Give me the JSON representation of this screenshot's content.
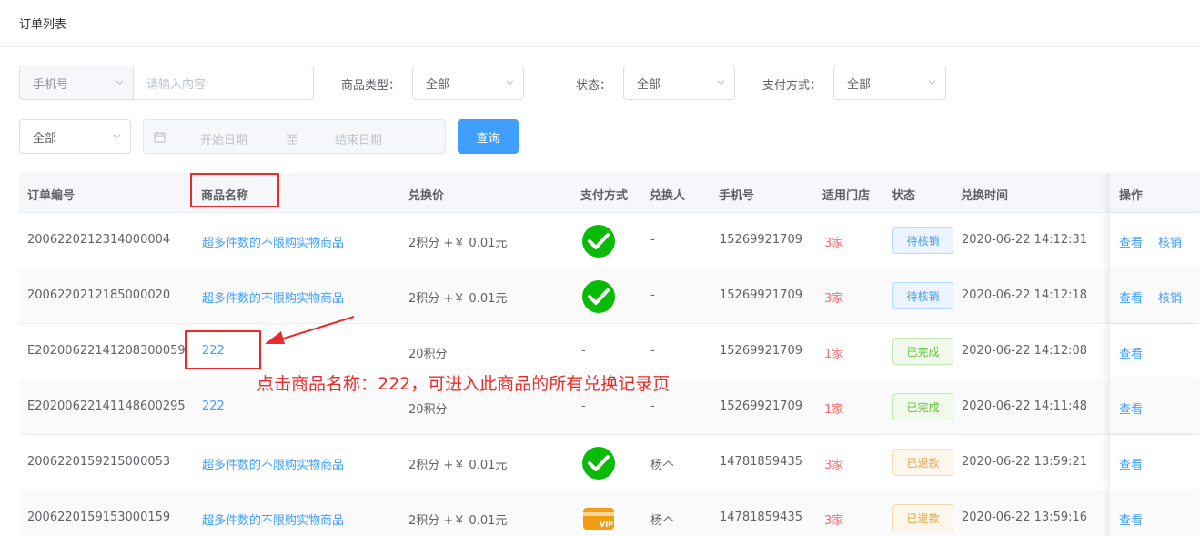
{
  "page": {
    "title": "订单列表"
  },
  "filters": {
    "search_type": "手机号",
    "search_placeholder": "请输入内容",
    "product_type_label": "商品类型：",
    "product_type_value": "全部",
    "status_label": "状态：",
    "status_value": "全部",
    "pay_method_label": "支付方式：",
    "pay_method_value": "全部",
    "store_value": "全部",
    "start_date_placeholder": "开始日期",
    "date_separator": "至",
    "end_date_placeholder": "结束日期",
    "query_button": "查询"
  },
  "table": {
    "headers": {
      "order_no": "订单编号",
      "product_name": "商品名称",
      "price": "兑换价",
      "pay_method": "支付方式",
      "redeemer": "兑换人",
      "phone": "手机号",
      "stores": "适用门店",
      "status": "状态",
      "time": "兑换时间",
      "actions": "操作"
    },
    "rows": [
      {
        "order_no": "2006220212314000004",
        "product": "超多件数的不限购实物商品",
        "price": "2积分 +￥ 0.01元",
        "pay": "wechat-pay-icon",
        "redeemer": "-",
        "phone": "15269921709",
        "stores": "3家",
        "status": "待核销",
        "status_type": "pending",
        "time": "2020-06-22 14:12:31",
        "view": "查看",
        "verify": "核销"
      },
      {
        "order_no": "2006220212185000020",
        "product": "超多件数的不限购实物商品",
        "price": "2积分 +￥ 0.01元",
        "pay": "wechat-pay-icon",
        "redeemer": "-",
        "phone": "15269921709",
        "stores": "3家",
        "status": "待核销",
        "status_type": "pending",
        "time": "2020-06-22 14:12:18",
        "view": "查看",
        "verify": "核销"
      },
      {
        "order_no": "E20200622141208300059",
        "product": "222",
        "price": "20积分",
        "pay": "-",
        "redeemer": "-",
        "phone": "15269921709",
        "stores": "1家",
        "status": "已完成",
        "status_type": "done",
        "time": "2020-06-22 14:12:08",
        "view": "查看",
        "verify": ""
      },
      {
        "order_no": "E20200622141148600295",
        "product": "222",
        "price": "20积分",
        "pay": "-",
        "redeemer": "-",
        "phone": "15269921709",
        "stores": "1家",
        "status": "已完成",
        "status_type": "done",
        "time": "2020-06-22 14:11:48",
        "view": "查看",
        "verify": ""
      },
      {
        "order_no": "2006220159215000053",
        "product": "超多件数的不限购实物商品",
        "price": "2积分 +￥ 0.01元",
        "pay": "wechat-pay-icon",
        "redeemer": "杨𠆢",
        "phone": "14781859435",
        "stores": "3家",
        "status": "已退款",
        "status_type": "refund",
        "time": "2020-06-22 13:59:21",
        "view": "查看",
        "verify": ""
      },
      {
        "order_no": "2006220159153000159",
        "product": "超多件数的不限购实物商品",
        "price": "2积分 +￥ 0.01元",
        "pay": "vip-card-icon",
        "redeemer": "杨𠆢",
        "phone": "14781859435",
        "stores": "3家",
        "status": "已退款",
        "status_type": "refund",
        "time": "2020-06-22 13:59:16",
        "view": "查看",
        "verify": ""
      }
    ]
  },
  "annotation": {
    "text": "点击商品名称：222，可进入此商品的所有兑换记录页",
    "color": "#e82c2c"
  },
  "colors": {
    "primary": "#409eff",
    "wechat_green": "#09bb07",
    "vip_orange": "#f39c12"
  }
}
